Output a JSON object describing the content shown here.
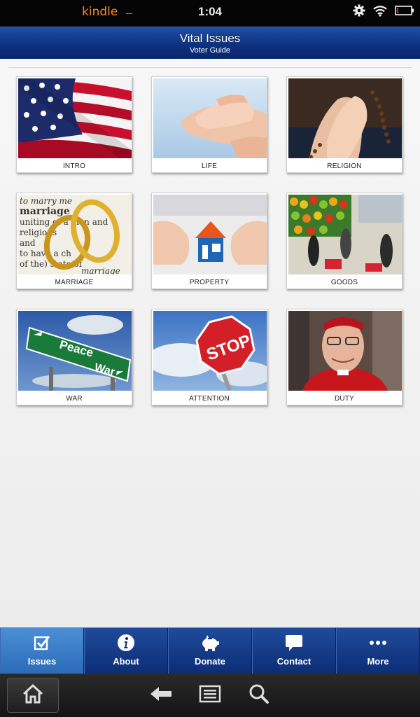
{
  "status_bar": {
    "app_name": "kindle",
    "time": "1:04",
    "icons": [
      "gear-icon",
      "wifi-icon",
      "battery-icon"
    ]
  },
  "header": {
    "title": "Vital Issues",
    "subtitle": "Voter Guide"
  },
  "issues": [
    {
      "label": "INTRO",
      "image": "american-flag"
    },
    {
      "label": "LIFE",
      "image": "holding-hands"
    },
    {
      "label": "RELIGION",
      "image": "praying-hands-rosary"
    },
    {
      "label": "MARRIAGE",
      "image": "wedding-rings-dictionary"
    },
    {
      "label": "PROPERTY",
      "image": "hands-protecting-house"
    },
    {
      "label": "GOODS",
      "image": "grocery-market"
    },
    {
      "label": "WAR",
      "image": "peace-war-sign"
    },
    {
      "label": "ATTENTION",
      "image": "stop-sign"
    },
    {
      "label": "DUTY",
      "image": "cardinal-portrait"
    }
  ],
  "sign_text": {
    "peace": "Peace",
    "war": "War",
    "stop": "STOP",
    "dict_lines": [
      "to marry me",
      "marriage",
      "uniting of a man and",
      "religious",
      "and",
      "to have a ch",
      "of the) state of",
      "marriage"
    ]
  },
  "tabs": [
    {
      "label": "Issues",
      "icon": "checkbox-icon",
      "active": true
    },
    {
      "label": "About",
      "icon": "info-icon",
      "active": false
    },
    {
      "label": "Donate",
      "icon": "piggy-bank-icon",
      "active": false
    },
    {
      "label": "Contact",
      "icon": "speech-bubble-icon",
      "active": false
    },
    {
      "label": "More",
      "icon": "more-dots-icon",
      "active": false
    }
  ],
  "colors": {
    "header_blue": "#0c2f7d",
    "tab_active": "#3a7dc8",
    "kindle_orange": "#f08a24"
  }
}
